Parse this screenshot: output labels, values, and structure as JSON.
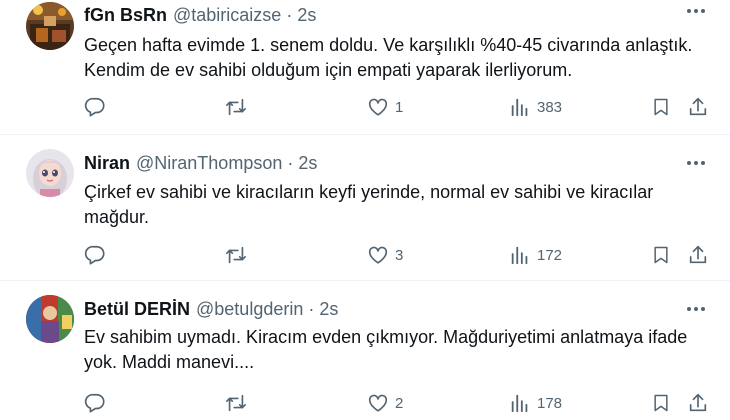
{
  "posts": [
    {
      "name": "fGn BsRn",
      "handle": "@tabiricaizse",
      "time": "2s",
      "lines": [
        "Geçen hafta evimde 1. senem doldu. Ve karşılıklı %40-45 civarında anlaştık.",
        "Kendim de ev sahibi olduğum için empati yaparak ilerliyorum."
      ],
      "likes": "1",
      "views": "383"
    },
    {
      "name": "Niran",
      "handle": "@NiranThompson",
      "time": "2s",
      "lines": [
        "Çirkef ev sahibi ve kiracıların keyfi yerinde, normal ev sahibi ve kiracılar",
        "mağdur."
      ],
      "likes": "3",
      "views": "172"
    },
    {
      "name": "Betül DERİN",
      "handle": "@betulgderin",
      "time": "2s",
      "lines": [
        "Ev sahibim uymadı.  Kiracım evden çıkmıyor. Mağduriyetimi anlatmaya ifade",
        "yok. Maddi manevi...."
      ],
      "likes": "2",
      "views": "178"
    }
  ],
  "separator": "·",
  "icons": {
    "reply": "reply-icon",
    "repost": "repost-icon",
    "like": "like-icon",
    "views": "views-icon",
    "bookmark": "bookmark-icon",
    "share": "share-icon",
    "more": "more-icon"
  },
  "colors": {
    "text": "#0f1419",
    "secondary": "#536471",
    "divider": "#eff3f4"
  }
}
